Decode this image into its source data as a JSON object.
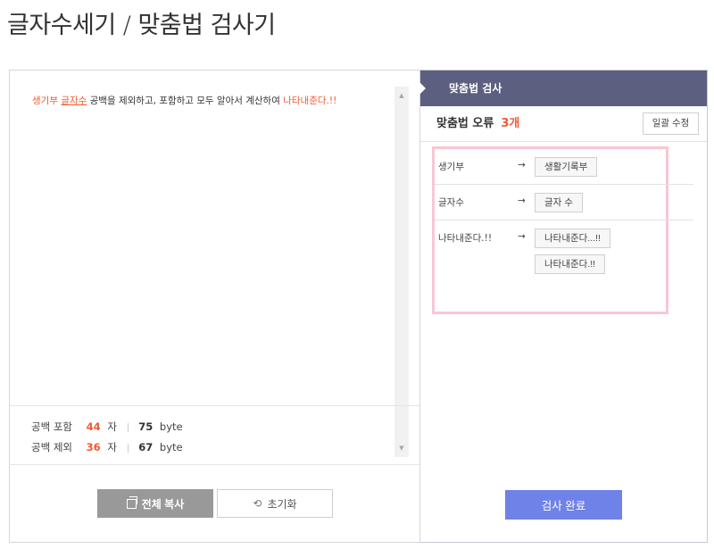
{
  "page": {
    "title": "글자수세기 / 맞춤법 검사기"
  },
  "editor": {
    "segments": [
      {
        "text": "생기부",
        "style": "err"
      },
      {
        "text": " ",
        "style": ""
      },
      {
        "text": "글자수",
        "style": "err underline"
      },
      {
        "text": " 공백을 제외하고, 포함하고 모두 알아서 계산하여 ",
        "style": ""
      },
      {
        "text": "나타내준다.!!",
        "style": "err"
      }
    ]
  },
  "stats": {
    "with_space": {
      "label": "공백 포함",
      "chars": "44",
      "char_unit": "자",
      "bytes": "75",
      "byte_unit": "byte"
    },
    "without_space": {
      "label": "공백 제외",
      "chars": "36",
      "char_unit": "자",
      "bytes": "67",
      "byte_unit": "byte"
    }
  },
  "buttons": {
    "copy_all": "전체 복사",
    "reset": "초기화",
    "fix_all": "일괄 수정",
    "done": "검사 완료"
  },
  "side": {
    "header": "맞춤법 검사",
    "error_label": "맞춤법 오류",
    "error_count": "3개",
    "errors": [
      {
        "word": "생기부",
        "arrow": "→",
        "suggestions": [
          "생활기록부"
        ]
      },
      {
        "word": "글자수",
        "arrow": "→",
        "suggestions": [
          "글자 수"
        ]
      },
      {
        "word": "나타내준다.!!",
        "arrow": "→",
        "suggestions": [
          "나타내준다...!!",
          "나타내준다.!!"
        ]
      }
    ]
  },
  "colors": {
    "accent_error": "#f05a32",
    "side_header": "#5c5f7f",
    "done_button": "#6f82e8",
    "highlight_border": "#f8c7d4"
  },
  "icons": {
    "copy": "copy-icon",
    "reset": "reset-icon",
    "scroll_up": "scroll-up-arrow",
    "scroll_down": "scroll-down-arrow"
  }
}
